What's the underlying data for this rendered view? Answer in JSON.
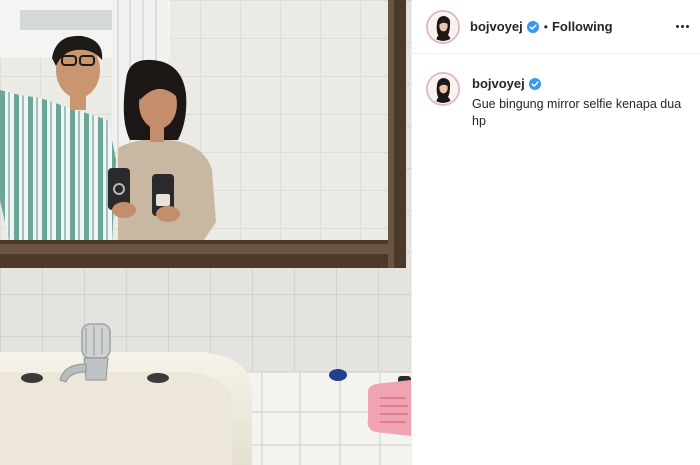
{
  "post": {
    "image_alt": "Mirror selfie of two people in a bathroom, each holding a phone",
    "colors": {
      "tile_wall": "#e6e5e1",
      "mirror_frame": "#4b3a2c",
      "sink": "#f2efe6",
      "accent_pink": "#f0a4b3"
    }
  },
  "header": {
    "username": "bojvoyej",
    "separator": "•",
    "follow_status": "Following",
    "verified_icon": "verified-badge-icon",
    "more_icon": "more-options-icon"
  },
  "caption": {
    "username": "bojvoyej",
    "text": "Gue bingung mirror selfie kenapa dua hp"
  }
}
